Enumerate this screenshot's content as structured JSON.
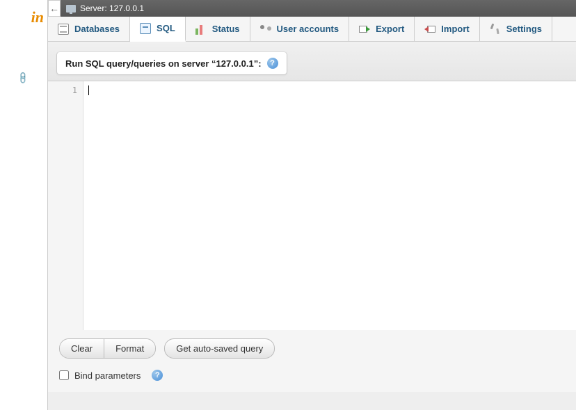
{
  "logo_fragment": "in",
  "topbar": {
    "collapse_glyph": "←",
    "server_label": "Server: 127.0.0.1"
  },
  "tabs": {
    "databases": "Databases",
    "sql": "SQL",
    "status": "Status",
    "user_accounts": "User accounts",
    "export": "Export",
    "import": "Import",
    "settings": "Settings"
  },
  "query_header": "Run SQL query/queries on server “127.0.0.1”:",
  "editor": {
    "line_number": "1",
    "content": ""
  },
  "buttons": {
    "clear": "Clear",
    "format": "Format",
    "autosaved": "Get auto-saved query"
  },
  "bind_parameters_label": "Bind parameters",
  "help_glyph": "?"
}
